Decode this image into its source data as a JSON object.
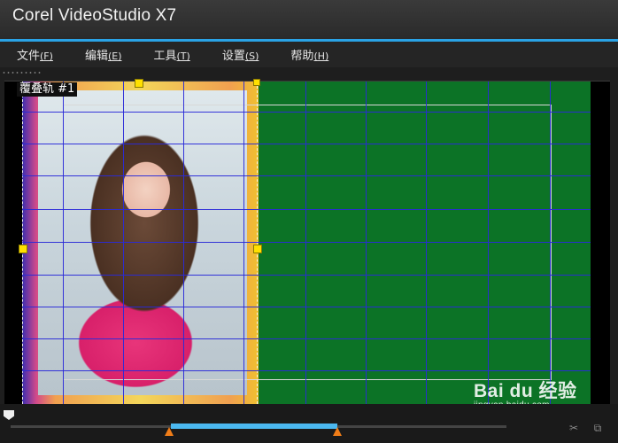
{
  "titlebar": {
    "title": "Corel VideoStudio X7"
  },
  "menu": {
    "items": [
      {
        "label": "文件",
        "key": "(F)"
      },
      {
        "label": "编辑",
        "key": "(E)"
      },
      {
        "label": "工具",
        "key": "(T)"
      },
      {
        "label": "设置",
        "key": "(S)"
      },
      {
        "label": "帮助",
        "key": "(H)"
      }
    ]
  },
  "preview": {
    "track_label": "覆叠轨 #1"
  },
  "watermark": {
    "logo": "Bai du 经验",
    "url": "jingyan.baidu.com"
  },
  "colors": {
    "accent": "#2aa3e6",
    "canvas_green": "#0c7326",
    "grid": "#2a2ad8",
    "range": "#4bb8f0",
    "marker": "#f07d18"
  }
}
